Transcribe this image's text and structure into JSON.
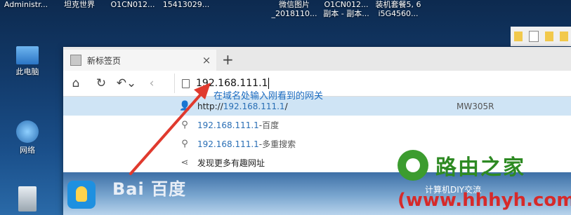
{
  "desktop": {
    "top_icons": [
      {
        "label": "Administr..."
      },
      {
        "label": "坦克世界"
      },
      {
        "label": "O1CN012..."
      },
      {
        "label": "15413029..."
      },
      {
        "label": "微信图片 _2018110..."
      },
      {
        "label": "O1CN012... 副本 - 副本..."
      },
      {
        "label": "装机套餐5, 6 i5G4560..."
      }
    ],
    "left_icons": [
      {
        "label": "此电脑"
      },
      {
        "label": "网络"
      }
    ]
  },
  "browser": {
    "tab_title": "新标签页",
    "tab_close": "×",
    "new_tab": "+",
    "nav": {
      "home": "⌂",
      "refresh": "↻",
      "undo": "↶⌄",
      "back": "‹"
    },
    "address": "192.168.111.1"
  },
  "dropdown": {
    "rows": [
      {
        "icon": "user-icon",
        "prefix": "http://",
        "url": "192.168.111.1",
        "suffix": "/",
        "right": "MW305R",
        "selected": true
      },
      {
        "icon": "search-icon",
        "url": "192.168.111.1",
        "sep": " - ",
        "engine": "百度"
      },
      {
        "icon": "search-icon",
        "url": "192.168.111.1",
        "sep": " - ",
        "engine": "多重搜索"
      },
      {
        "icon": "share-icon",
        "plain": "发现更多有趣网址"
      }
    ]
  },
  "annotation": {
    "text": "在域名处输入刚看到的网关",
    "color": "#1a6bc0",
    "arrow_color": "#e03a2e"
  },
  "background": {
    "baidu_logo": "Bai 百度"
  },
  "watermark": {
    "title": "路由之家",
    "subtitle": "计算机DIY交流",
    "url": "(www.hhhyh.com)",
    "brand_color": "#2e8a23",
    "url_color": "#d62a2a"
  }
}
